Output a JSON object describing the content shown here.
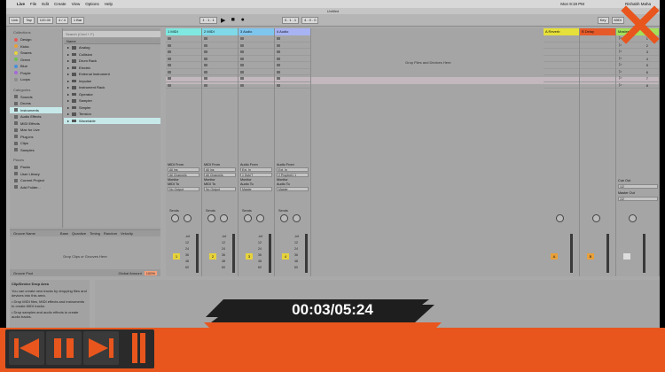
{
  "menubar": {
    "apple": "",
    "app": "Live",
    "items": [
      "File",
      "Edit",
      "Create",
      "View",
      "Options",
      "Help"
    ],
    "clock": "Mon 9:19 PM",
    "user": "Rishabh Maha"
  },
  "window": {
    "title": "Untitled"
  },
  "toolbar": {
    "link": "Link",
    "tap": "Tap",
    "tempo": "120.00",
    "signature": "4 / 4",
    "quant": "1 Bar",
    "position": "1 . 1 . 1",
    "loop_start": "3 . 1 . 1",
    "loop_len": "4 . 0 . 0",
    "key": "Key",
    "midi": "MIDI"
  },
  "browser": {
    "search_placeholder": "Search (Cmd + F)",
    "collections_title": "Collections",
    "collections": [
      {
        "label": "Design",
        "color": "#e45b5b"
      },
      {
        "label": "Kicks",
        "color": "#e8a03a"
      },
      {
        "label": "Snares",
        "color": "#e6d23a"
      },
      {
        "label": "Green",
        "color": "#6dc052"
      },
      {
        "label": "Blue",
        "color": "#4a8fd8"
      },
      {
        "label": "Purple",
        "color": "#a26ad6"
      },
      {
        "label": "Loops",
        "color": "#8d8d8d"
      }
    ],
    "categories_title": "Categories",
    "categories": [
      "Sounds",
      "Drums",
      "Instruments",
      "Audio Effects",
      "MIDI Effects",
      "Max for Live",
      "Plug-ins",
      "Clips",
      "Samples"
    ],
    "selected_category": "Instruments",
    "places_title": "Places",
    "places": [
      "Packs",
      "User Library",
      "Current Project",
      "Add Folder..."
    ],
    "files_header": "Name",
    "files": [
      "Analog",
      "Collision",
      "Drum Rack",
      "Electric",
      "External Instrument",
      "Impulse",
      "Instrument Rack",
      "Operator",
      "Sampler",
      "Simpler",
      "Tension",
      "Wavetable"
    ],
    "selected_file": "Wavetable"
  },
  "groove": {
    "columns": [
      "Groove Name",
      "Base",
      "Quantize",
      "Timing",
      "Random",
      "Velocity"
    ],
    "message": "Drop Clips or Grooves Here",
    "pool_label": "Groove Pool",
    "global_amount_label": "Global Amount",
    "global_amount": "100%"
  },
  "tracks": [
    {
      "name": "1 MIDI",
      "color": "#7fe8e0",
      "num": "1",
      "from": "MIDI From",
      "from_val": "All Ins",
      "ch": "All Channels",
      "monitor": "Monitor",
      "to": "MIDI To",
      "to_val": "No Output"
    },
    {
      "name": "2 MIDI",
      "color": "#7fd9e8",
      "num": "2",
      "from": "MIDI From",
      "from_val": "All Ins",
      "ch": "All Channels",
      "monitor": "Monitor",
      "to": "MIDI To",
      "to_val": "No Output"
    },
    {
      "name": "3 Audio",
      "color": "#7fc6ef",
      "num": "3",
      "from": "Audio From",
      "from_val": "Ext. In",
      "ch": "1 Sub/T",
      "monitor": "Monitor",
      "to": "Audio To",
      "to_val": "Master"
    },
    {
      "name": "4 Audio",
      "color": "#a7b3f2",
      "num": "4",
      "from": "Audio From",
      "from_val": "Ext. In",
      "ch": "2 Prophet1 1",
      "monitor": "Monitor",
      "to": "Audio To",
      "to_val": "Master"
    }
  ],
  "returns": [
    {
      "name": "A Reverb",
      "color": "#e6e03a",
      "letter": "A"
    },
    {
      "name": "B Delay",
      "color": "#e65a2a",
      "letter": "B"
    }
  ],
  "master": {
    "name": "Master",
    "color": "#a5e05a",
    "scenes": [
      "1",
      "2",
      "3",
      "4",
      "5",
      "6",
      "7",
      "8"
    ],
    "cue_out": "Cue Out",
    "cue_val": "1/2",
    "master_out": "Master Out",
    "master_val": "1/2"
  },
  "mixer": {
    "sends": "Sends",
    "db_marks": [
      "-Inf",
      "12",
      "24",
      "36",
      "48",
      "60"
    ],
    "in_auto": [
      "In",
      "Auto",
      "Off"
    ]
  },
  "drop_message": "Drop Files and Devices Here",
  "info": {
    "title": "Clip/Device Drop Area",
    "lines": [
      "You can create new tracks by dropping files and devices into this area.",
      "• Drop MIDI files, MIDI effects and instruments to create MIDI tracks.",
      "• Drop samples and audio effects to create audio tracks."
    ]
  },
  "player": {
    "time": "00:03/05:24",
    "accent": "#e8561e",
    "controls": [
      "skip-back-icon",
      "pause-icon",
      "skip-forward-icon",
      "progress-marker-icon"
    ]
  }
}
